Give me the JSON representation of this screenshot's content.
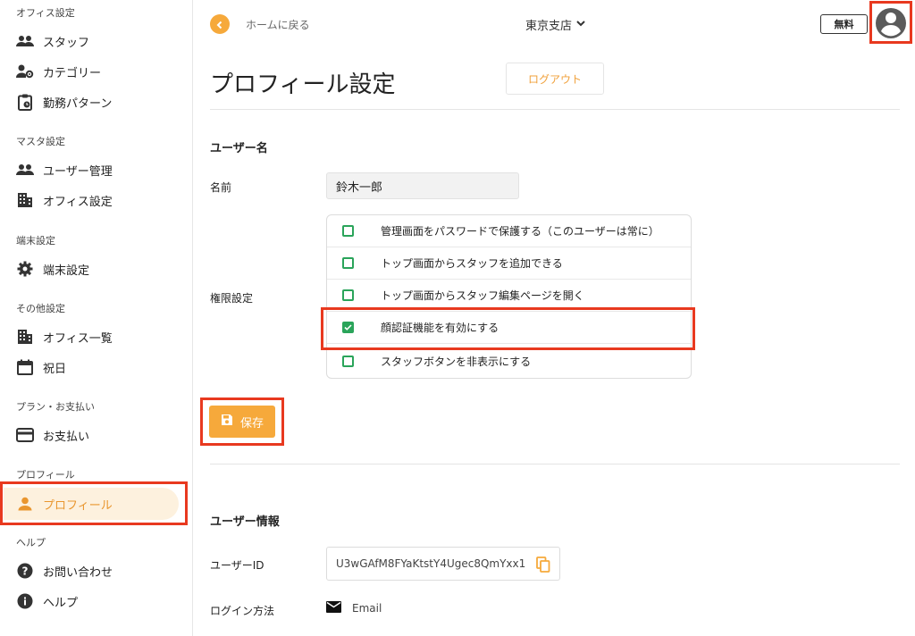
{
  "sidebar": {
    "sections": [
      {
        "label": "オフィス設定",
        "items": [
          {
            "label": "スタッフ",
            "icon": "group-icon"
          },
          {
            "label": "カテゴリー",
            "icon": "person-gear-icon"
          },
          {
            "label": "勤務パターン",
            "icon": "clipboard-clock-icon"
          }
        ]
      },
      {
        "label": "マスタ設定",
        "items": [
          {
            "label": "ユーザー管理",
            "icon": "group-icon"
          },
          {
            "label": "オフィス設定",
            "icon": "building-icon"
          }
        ]
      },
      {
        "label": "端末設定",
        "items": [
          {
            "label": "端末設定",
            "icon": "gear-icon"
          }
        ]
      },
      {
        "label": "その他設定",
        "items": [
          {
            "label": "オフィス一覧",
            "icon": "building-icon"
          },
          {
            "label": "祝日",
            "icon": "calendar-icon"
          }
        ]
      },
      {
        "label": "プラン・お支払い",
        "items": [
          {
            "label": "お支払い",
            "icon": "credit-card-icon"
          }
        ]
      },
      {
        "label": "プロフィール",
        "items": [
          {
            "label": "プロフィール",
            "icon": "person-icon",
            "active": true
          }
        ]
      },
      {
        "label": "ヘルプ",
        "items": [
          {
            "label": "お問い合わせ",
            "icon": "help-circle-icon"
          },
          {
            "label": "ヘルプ",
            "icon": "info-icon"
          }
        ]
      }
    ]
  },
  "topbar": {
    "back_label": "ホームに戻る",
    "branch": "東京支店",
    "plan": "無料"
  },
  "page": {
    "title": "プロフィール設定",
    "logout_label": "ログアウト",
    "username_section": "ユーザー名",
    "name_label": "名前",
    "name_value": "鈴木一郎",
    "permissions_label": "権限設定",
    "permissions": [
      {
        "label": "管理画面をパスワードで保護する（このユーザーは常に）",
        "checked": false
      },
      {
        "label": "トップ画面からスタッフを追加できる",
        "checked": false
      },
      {
        "label": "トップ画面からスタッフ編集ページを開く",
        "checked": false
      },
      {
        "label": "顔認証機能を有効にする",
        "checked": true
      },
      {
        "label": "スタッフボタンを非表示にする",
        "checked": false
      }
    ],
    "save_label": "保存",
    "userinfo_section": "ユーザー情報",
    "userid_label": "ユーザーID",
    "userid_value": "U3wGAfM8FYaKtstY4Ugec8QmYxx1",
    "login_method_label": "ログイン方法",
    "login_method_value": "Email"
  },
  "colors": {
    "accent": "#f6a93b",
    "check": "#2aa45a",
    "highlight": "#e8391f",
    "active_bg": "#fdf1de"
  }
}
